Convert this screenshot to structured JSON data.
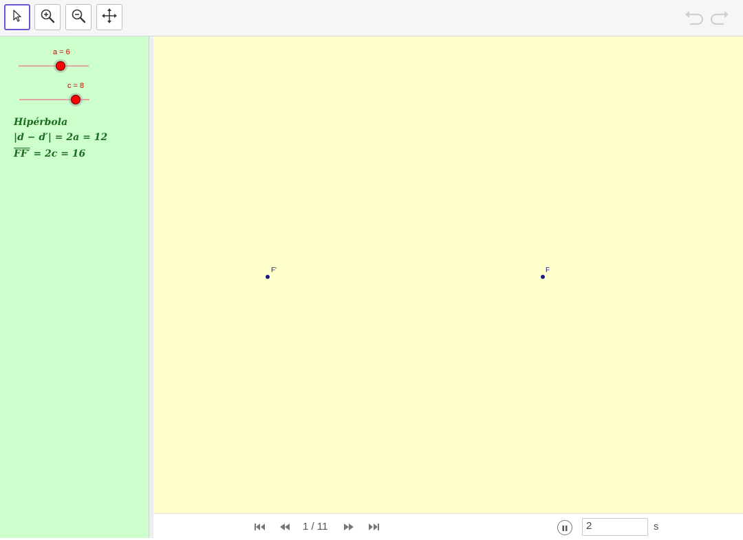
{
  "toolbar": {
    "tools": [
      {
        "icon": "cursor-icon",
        "active": true
      },
      {
        "icon": "zoom-in-icon",
        "active": false
      },
      {
        "icon": "zoom-out-icon",
        "active": false
      },
      {
        "icon": "move-view-icon",
        "active": false
      }
    ],
    "undo_icon": "undo-icon",
    "redo_icon": "redo-icon"
  },
  "sliders": [
    {
      "label": "a = 6",
      "value": 6
    },
    {
      "label": "c = 8",
      "value": 8
    }
  ],
  "algebra": {
    "line1": "Hipérbola",
    "line2": "|d − d′| = 2a = 12",
    "line3_over": "FF′",
    "line3_rest": " = 2c = 16"
  },
  "graphics": {
    "points": [
      {
        "name": "F'",
        "color": "#1a1a8c"
      },
      {
        "name": "F",
        "color": "#1a1a8c"
      }
    ]
  },
  "animation": {
    "frame": "1 / 11",
    "speed_value": "2",
    "speed_unit": "s"
  },
  "colors": {
    "graphics_bg": "#ffffcc",
    "algebra_bg": "#ccffcc",
    "slider_color": "#ff0000",
    "accent": "#6557d2"
  }
}
